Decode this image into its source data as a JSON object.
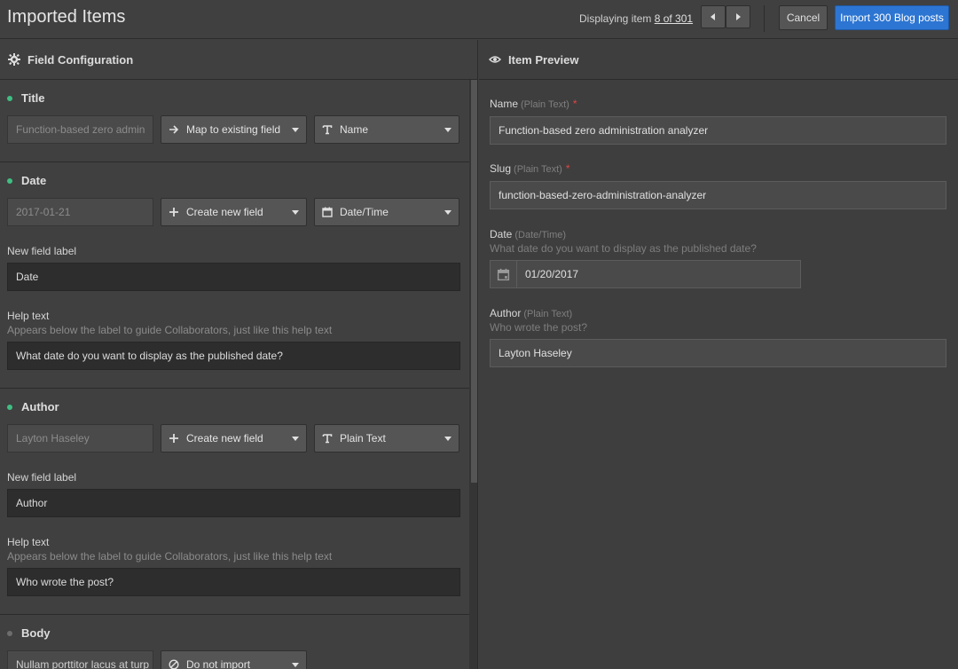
{
  "header": {
    "title": "Imported Items",
    "displaying_prefix": "Displaying item ",
    "displaying_link": "8 of 301",
    "cancel_label": "Cancel",
    "import_label": "Import 300 Blog posts",
    "accent_color": "#2d75d2"
  },
  "left_panel": {
    "title": "Field Configuration",
    "icon": "gear-icon"
  },
  "right_panel": {
    "title": "Item Preview",
    "icon": "eye-icon"
  },
  "sections": {
    "title": {
      "name": "Title",
      "sample": "Function-based zero admin",
      "action": "Map to existing field",
      "type": "Name"
    },
    "date": {
      "name": "Date",
      "sample": "2017-01-21",
      "action": "Create new field",
      "type": "Date/Time",
      "label_caption": "New field label",
      "label_value": "Date",
      "help_caption": "Help text",
      "help_hint": "Appears below the label to guide Collaborators, just like this help text",
      "help_value": "What date do you want to display as the published date?"
    },
    "author": {
      "name": "Author",
      "sample": "Layton Haseley",
      "action": "Create new field",
      "type": "Plain Text",
      "label_caption": "New field label",
      "label_value": "Author",
      "help_caption": "Help text",
      "help_hint": "Appears below the label to guide Collaborators, just like this help text",
      "help_value": "Who wrote the post?"
    },
    "body": {
      "name": "Body",
      "sample": "Nullam porttitor lacus at turp",
      "action": "Do not import"
    }
  },
  "preview": {
    "name": {
      "label": "Name",
      "type": "(Plain Text)",
      "required": "*",
      "value": "Function-based zero administration analyzer"
    },
    "slug": {
      "label": "Slug",
      "type": "(Plain Text)",
      "required": "*",
      "value": "function-based-zero-administration-analyzer"
    },
    "date": {
      "label": "Date",
      "type": "(Date/Time)",
      "hint": "What date do you want to display as the published date?",
      "value": "01/20/2017"
    },
    "author": {
      "label": "Author",
      "type": "(Plain Text)",
      "hint": "Who wrote the post?",
      "value": "Layton Haseley"
    }
  }
}
